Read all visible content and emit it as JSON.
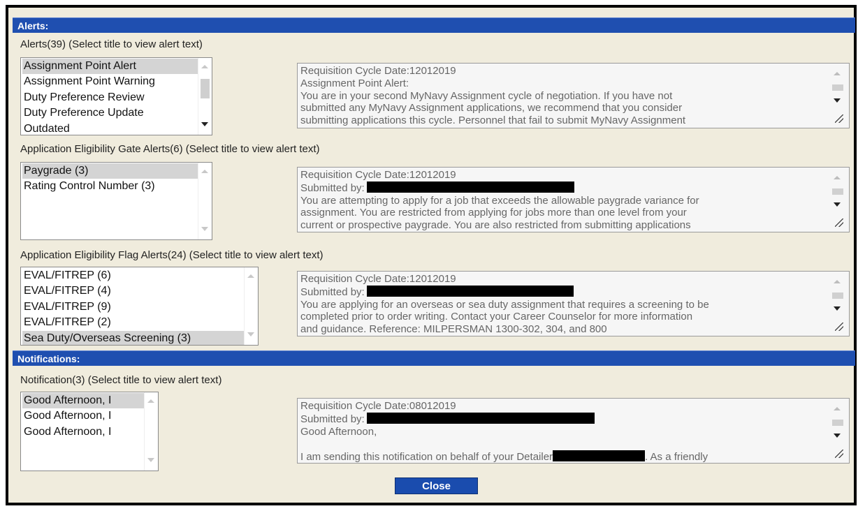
{
  "alerts": {
    "header": "Alerts:",
    "label": "Alerts(39) (Select title to view alert text)",
    "items": [
      "Assignment Point Alert",
      "Assignment Point Warning",
      "Duty Preference Review",
      "Duty Preference Update",
      "Outdated"
    ],
    "selected_index": 0,
    "text": {
      "line1": "Requisition Cycle Date:12012019",
      "line2": "Assignment Point Alert:",
      "line3": "You are in your second MyNavy Assignment cycle of negotiation.  If you have not",
      "line4": "submitted any MyNavy Assignment applications, we recommend that you consider",
      "line5": "submitting applications this cycle. Personnel that fail to submit MyNavy Assignment"
    }
  },
  "gate_alerts": {
    "label": "Application Eligibility Gate Alerts(6) (Select title to view alert text)",
    "items": [
      "Paygrade (3)",
      "Rating Control Number (3)"
    ],
    "selected_index": 0,
    "text": {
      "line1": "Requisition Cycle Date:12012019",
      "line2": "Submitted by:",
      "line3": "You are attempting to apply for a job that exceeds the allowable paygrade variance for",
      "line4": "assignment. You are restricted from applying for jobs more than one level from your",
      "line5": "current or prospective paygrade. You are also restricted from submitting applications"
    }
  },
  "flag_alerts": {
    "label": "Application Eligibility Flag Alerts(24) (Select title to view alert text)",
    "items": [
      "EVAL/FITREP (6)",
      "EVAL/FITREP (4)",
      "EVAL/FITREP (9)",
      "EVAL/FITREP (2)",
      "Sea Duty/Overseas Screening (3)"
    ],
    "selected_index": 4,
    "text": {
      "line1": "Requisition Cycle Date:12012019",
      "line2": "Submitted by:",
      "line3": "You are applying for an overseas or sea duty assignment that requires a screening to be",
      "line4": "completed prior to order writing. Contact your Career Counselor for more information",
      "line5": "and guidance. Reference: MILPERSMAN 1300-302, 304, and 800"
    }
  },
  "notifications": {
    "header": "Notifications:",
    "label": "Notification(3) (Select title to view alert text)",
    "items": [
      "Good Afternoon, I",
      "Good Afternoon, I",
      "Good Afternoon, I"
    ],
    "selected_index": 0,
    "text": {
      "line1": "Requisition Cycle Date:08012019",
      "line2": "Submitted by:",
      "line3": "Good Afternoon,",
      "line4": "",
      "line5a": "I am sending this notification on behalf of your Detailer",
      "line5b": ". As a friendly"
    }
  },
  "close_label": "Close",
  "colors": {
    "header_bg": "#1f4fb0",
    "panel_bg": "#f0ecdd",
    "button_bg": "#1a4cae"
  }
}
